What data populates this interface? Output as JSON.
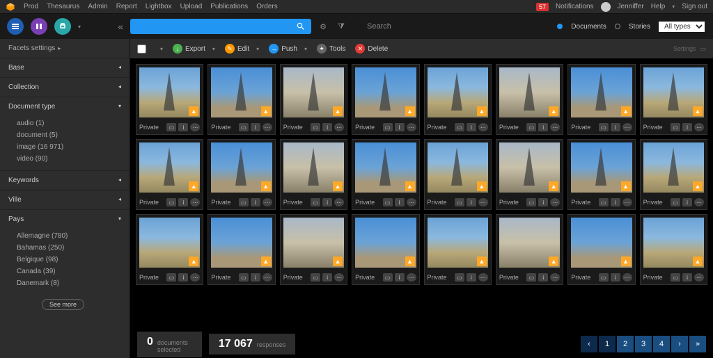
{
  "topnav": {
    "items": [
      "Prod",
      "Thesaurus",
      "Admin",
      "Report",
      "Lightbox",
      "Upload",
      "Publications",
      "Orders"
    ],
    "notif_count": "57",
    "notif_label": "Notifications",
    "user": "Jenniffer",
    "help": "Help",
    "signout": "Sign out"
  },
  "search": {
    "label": "Search",
    "radios": [
      {
        "label": "Documents",
        "on": true
      },
      {
        "label": "Stories",
        "on": false
      }
    ],
    "type_select": "All types"
  },
  "sidebar": {
    "facets_settings": "Facets settings",
    "groups": [
      {
        "title": "Base",
        "open": false
      },
      {
        "title": "Collection",
        "open": false
      },
      {
        "title": "Document type",
        "open": true,
        "items": [
          "audio (1)",
          "document (5)",
          "image (16 971)",
          "video (90)"
        ]
      },
      {
        "title": "Keywords",
        "open": false
      },
      {
        "title": "Ville",
        "open": false
      },
      {
        "title": "Pays",
        "open": true,
        "items": [
          "Allemagne (780)",
          "Bahamas (250)",
          "Belgique (98)",
          "Canada (39)",
          "Danemark (8)"
        ],
        "see_more": "See more"
      }
    ]
  },
  "actions": {
    "export": "Export",
    "edit": "Edit",
    "push": "Push",
    "tools": "Tools",
    "delete": "Delete",
    "settings": "Settings"
  },
  "grid": {
    "label": "Private",
    "rows": 3,
    "cols": 8
  },
  "footer": {
    "selected_n": "0",
    "selected_l": "documents selected",
    "responses_n": "17 067",
    "responses_l": "responses",
    "pages": [
      "1",
      "2",
      "3",
      "4"
    ]
  }
}
